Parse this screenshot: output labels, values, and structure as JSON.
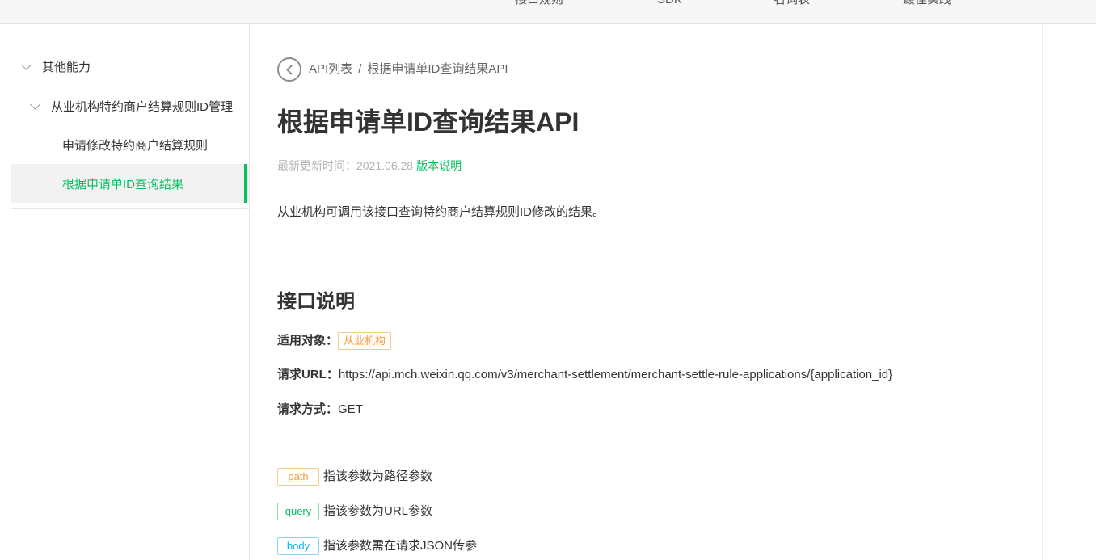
{
  "topnav": {
    "items": [
      "接口规则",
      "SDK",
      "名词表",
      "最佳实践"
    ]
  },
  "sidebar": {
    "items": [
      {
        "label": "其他能力"
      },
      {
        "label": "从业机构特约商户结算规则ID管理"
      },
      {
        "label": "申请修改特约商户结算规则"
      },
      {
        "label": "根据申请单ID查询结果"
      }
    ],
    "active_color": "#07c160"
  },
  "breadcrumb": {
    "root": "API列表",
    "separator": "/",
    "current": "根据申请单ID查询结果API"
  },
  "page": {
    "title": "根据申请单ID查询结果API",
    "updated_label": "最新更新时间：2021.06.28",
    "version_link": "版本说明",
    "description": "从业机构可调用该接口查询特约商户结算规则ID修改的结果。"
  },
  "api": {
    "section_title": "接口说明",
    "applicable_label": "适用对象：",
    "applicable_value": "从业机构",
    "url_label": "请求URL：",
    "url_value": "https://api.mch.weixin.qq.com/v3/merchant-settlement/merchant-settle-rule-applications/{application_id}",
    "method_label": "请求方式：",
    "method_value": "GET"
  },
  "param_legend": [
    {
      "tag": "path",
      "desc": "指该参数为路径参数",
      "color": "#fa9d3b"
    },
    {
      "tag": "query",
      "desc": "指该参数为URL参数",
      "color": "#07c160"
    },
    {
      "tag": "body",
      "desc": "指该参数需在请求JSON传参",
      "color": "#10aeff"
    }
  ]
}
